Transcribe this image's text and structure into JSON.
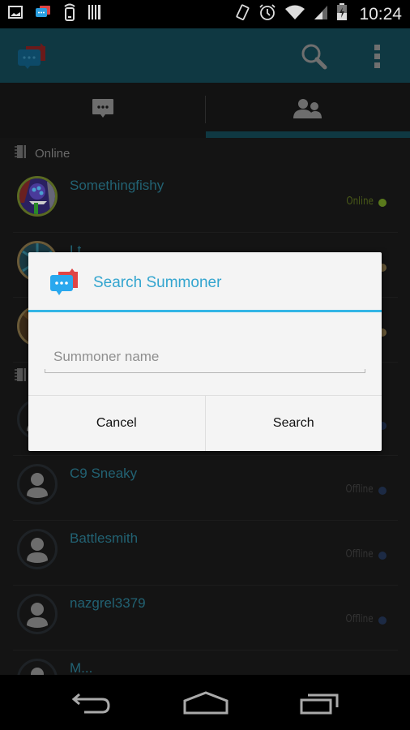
{
  "status_bar": {
    "time": "10:24",
    "left_icons": [
      "image-notification-icon",
      "chat-app-notification-icon",
      "phone-signal-icon",
      "barcode-icon"
    ],
    "right_icons": [
      "vibrate-icon",
      "alarm-icon",
      "wifi-icon",
      "cell-signal-icon",
      "battery-charging-icon"
    ]
  },
  "action_bar": {
    "logo_icon": "app-logo-icon",
    "search_icon": "search-icon",
    "menu_icon": "overflow-menu-icon",
    "color": "#0f3842"
  },
  "tabs": [
    {
      "icon": "chat-icon",
      "active": false
    },
    {
      "icon": "friends-icon",
      "active": true
    }
  ],
  "sections": [
    {
      "label": "Online"
    },
    {
      "label": ""
    }
  ],
  "friends": [
    {
      "name": "Somethingfishy",
      "status": "Online",
      "status_color": "#5c7a1c",
      "avatar": "champion"
    },
    {
      "name": "Lt...",
      "status": "",
      "status_color": "#8a7040",
      "avatar": "champion"
    },
    {
      "name": "",
      "status": "",
      "status_color": "#8a7040",
      "avatar": "champion"
    },
    {
      "name": "",
      "status": "",
      "status_color": "#1c2a44",
      "avatar": "default"
    },
    {
      "name": "C9 Sneaky",
      "status": "Offline",
      "status_color": "#1c2a44",
      "avatar": "default"
    },
    {
      "name": "Battlesmith",
      "status": "Offline",
      "status_color": "#1c2a44",
      "avatar": "default"
    },
    {
      "name": "nazgrel3379",
      "status": "Offline",
      "status_color": "#1c2a44",
      "avatar": "default"
    },
    {
      "name": "M...",
      "status": "",
      "status_color": "#1c2a44",
      "avatar": "default"
    }
  ],
  "dialog": {
    "title": "Search Summoner",
    "input_placeholder": "Summoner name",
    "input_value": "",
    "cancel_label": "Cancel",
    "search_label": "Search",
    "accent_color": "#33b5e5"
  },
  "nav_bar": {
    "back_icon": "back-icon",
    "home_icon": "home-icon",
    "recents_icon": "recents-icon"
  }
}
